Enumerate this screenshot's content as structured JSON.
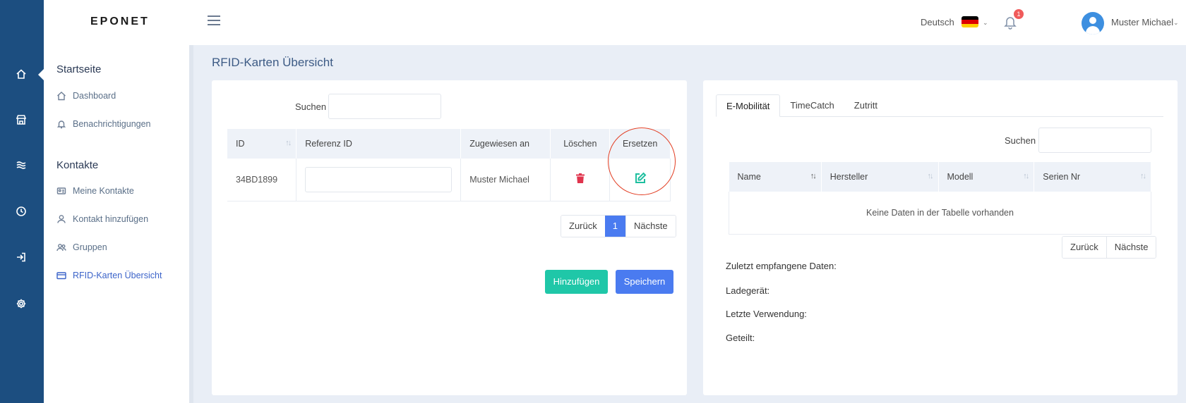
{
  "app": {
    "logo": "EPONET"
  },
  "topbar": {
    "language": "Deutsch",
    "notification_count": "1",
    "user_name": "Muster Michael"
  },
  "sidebar": {
    "sections": [
      {
        "title": "Startseite",
        "items": [
          {
            "label": "Dashboard",
            "icon": "home-icon"
          },
          {
            "label": "Benachrichtigungen",
            "icon": "bell-icon"
          }
        ]
      },
      {
        "title": "Kontakte",
        "items": [
          {
            "label": "Meine Kontakte",
            "icon": "contact-card-icon"
          },
          {
            "label": "Kontakt hinzufügen",
            "icon": "user-icon"
          },
          {
            "label": "Gruppen",
            "icon": "users-icon"
          },
          {
            "label": "RFID-Karten Übersicht",
            "icon": "credit-card-icon",
            "active": true
          }
        ]
      }
    ]
  },
  "rail": {
    "icons": [
      "home-icon",
      "store-icon",
      "waves-icon",
      "clock-icon",
      "login-icon",
      "gear-icon"
    ]
  },
  "main": {
    "page_title": "RFID-Karten Übersicht",
    "left": {
      "search_label": "Suchen",
      "columns": [
        "ID",
        "Referenz ID",
        "Zugewiesen an",
        "Löschen",
        "Ersetzen"
      ],
      "rows": [
        {
          "id": "34BD1899",
          "reference": "",
          "assigned_to": "Muster Michael"
        }
      ],
      "pager": {
        "prev": "Zurück",
        "current": "1",
        "next": "Nächste"
      },
      "buttons": {
        "add": "Hinzufügen",
        "save": "Speichern"
      }
    },
    "right": {
      "tabs": [
        "E-Mobilität",
        "TimeCatch",
        "Zutritt"
      ],
      "active_tab": "E-Mobilität",
      "search_label": "Suchen",
      "columns": [
        "Name",
        "Hersteller",
        "Modell",
        "Serien Nr"
      ],
      "empty_message": "Keine Daten in der Tabelle vorhanden",
      "pager": {
        "prev": "Zurück",
        "next": "Nächste"
      },
      "info": {
        "last_received": "Zuletzt empfangene Daten:",
        "charger": "Ladegerät:",
        "last_used": "Letzte Verwendung:",
        "shared": "Geteilt:"
      }
    }
  },
  "colors": {
    "rail": "#1c4e80",
    "primary": "#4a7bf0",
    "teal": "#1fc7a8",
    "danger": "#e0344d",
    "highlight_circle": "#e23d22"
  }
}
